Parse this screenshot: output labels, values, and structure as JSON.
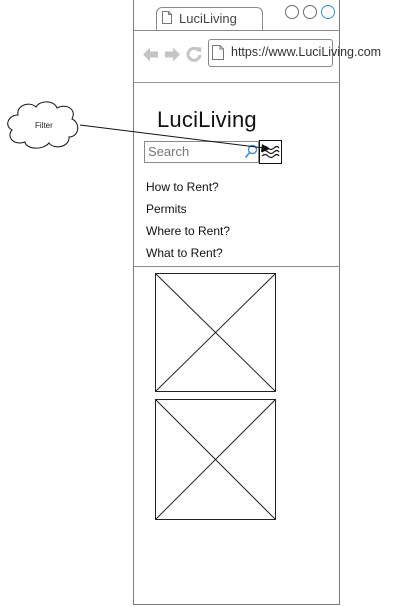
{
  "browser": {
    "tab_title": "LuciLiving",
    "url": "https://www.LuciLiving.com"
  },
  "site": {
    "title": "LuciLiving"
  },
  "search": {
    "placeholder": "Search"
  },
  "menu": {
    "items": [
      {
        "label": "How to Rent?"
      },
      {
        "label": "Permits"
      },
      {
        "label": "Where to Rent?"
      },
      {
        "label": "What to Rent?"
      }
    ]
  },
  "annotation": {
    "label": "Filter"
  },
  "colors": {
    "nav_arrows": "#c4c4c4",
    "window_button_active": "#3d8fd6",
    "frame": "#7a7a7a"
  }
}
